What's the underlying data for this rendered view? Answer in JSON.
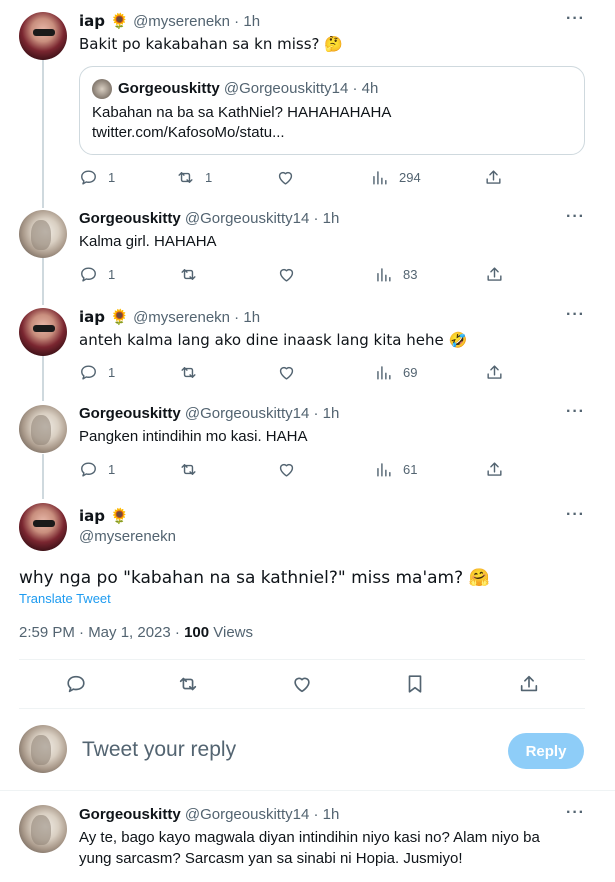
{
  "tweets": [
    {
      "name": "iap 🌻",
      "handle": "@myserenekn",
      "time": "1h",
      "text": "Bakit po kakabahan sa kn miss? 🤔",
      "quote": {
        "name": "Gorgeouskitty",
        "handle": "@Gorgeouskitty14",
        "time": "4h",
        "line1": "Kabahan na ba sa KathNiel? HAHAHAHAHA",
        "line2": "twitter.com/KafosoMo/statu..."
      },
      "replies": "1",
      "retweets": "1",
      "views": "294"
    },
    {
      "name": "Gorgeouskitty",
      "handle": "@Gorgeouskitty14",
      "time": "1h",
      "text": "Kalma girl. HAHAHA",
      "replies": "1",
      "views": "83"
    },
    {
      "name": "iap 🌻",
      "handle": "@myserenekn",
      "time": "1h",
      "text": "anteh kalma lang ako dine inaask lang kita hehe 🤣",
      "replies": "1",
      "views": "69"
    },
    {
      "name": "Gorgeouskitty",
      "handle": "@Gorgeouskitty14",
      "time": "1h",
      "text": "Pangken intindihin mo kasi. HAHA",
      "replies": "1",
      "views": "61"
    }
  ],
  "main": {
    "name": "iap 🌻",
    "handle": "@myserenekn",
    "text": "why nga po \"kabahan na sa kathniel?\" miss ma'am? 🤗",
    "translate": "Translate Tweet",
    "timestamp": "2:59 PM · May 1, 2023 · ",
    "views_count": "100",
    "views_label": " Views"
  },
  "composer": {
    "placeholder": "Tweet your reply",
    "button": "Reply"
  },
  "last_reply": {
    "name": "Gorgeouskitty",
    "handle": "@Gorgeouskitty14",
    "time": "1h",
    "line1": "Ay te, bago kayo magwala diyan intindihin niyo kasi no?  Alam niyo ba",
    "line2": "yung sarcasm? Sarcasm yan sa sinabi ni Hopia. Jusmiyo!"
  },
  "more_label": "···",
  "dot": " · ",
  "icons": [
    "reply-icon",
    "retweet-icon",
    "like-icon",
    "views-icon",
    "share-icon",
    "bookmark-icon",
    "more-icon"
  ],
  "colors": {
    "link": "#1d9bf0",
    "muted": "#536471",
    "reply_button": "#8ecdf8",
    "border": "#cfd9de"
  }
}
